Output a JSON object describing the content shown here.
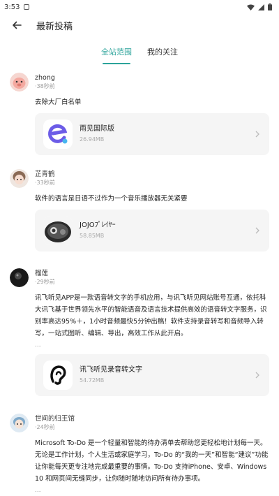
{
  "status_bar": {
    "time": "3:53"
  },
  "header": {
    "title": "最新投稿"
  },
  "tabs": [
    {
      "label": "全站范围",
      "active": true
    },
    {
      "label": "我的关注",
      "active": false
    }
  ],
  "posts": [
    {
      "user": "zhong",
      "time": "·38秒前",
      "text": "去除大厂白名单",
      "app": {
        "name": "雨见国际版",
        "size": "26.94MB"
      }
    },
    {
      "user": "芷青鹤",
      "time": "·33秒前",
      "text": "软件的语言是日语不过作为一个音乐播放器无关紧要",
      "app": {
        "name": "JOJOﾌﾟﾚｲﾔｰ",
        "size": "58.85MB"
      }
    },
    {
      "user": "榴莲",
      "time": "·29秒前",
      "text": "讯飞听见APP是一款语音转文字的手机应用，与讯飞听见网站账号互通，依托科大讯飞基于世界领先水平的智能语音及语言技术提供高效的语音转文字服务，识别率高达95%＋，1小时音频最快5分钟出稿！软件支持录音转写和音频导入转写，一站式图听、编辑、导出，高效工作从此开启。",
      "more": "...",
      "app": {
        "name": "讯飞听见录音转文字",
        "size": "54.72MB"
      }
    },
    {
      "user": "世间的归王馆",
      "time": "·24秒前",
      "text": "Microsoft To-Do 是一个轻量和智能的待办清单去帮助您更轻松地计划每一天。无论是工作计划，个人生活或家庭学习，To-Do 的“我的一天”和智能“建议”功能让你能每天更专注地完成最重要的事情。To-Do 支持iPhone、安卓、Windows 10 和网页间无缝同步，让你随时随地访问所有待办事项。",
      "more": "..."
    }
  ],
  "colors": {
    "accent": "#2ba39a",
    "card_bg": "#f5f5f5"
  }
}
